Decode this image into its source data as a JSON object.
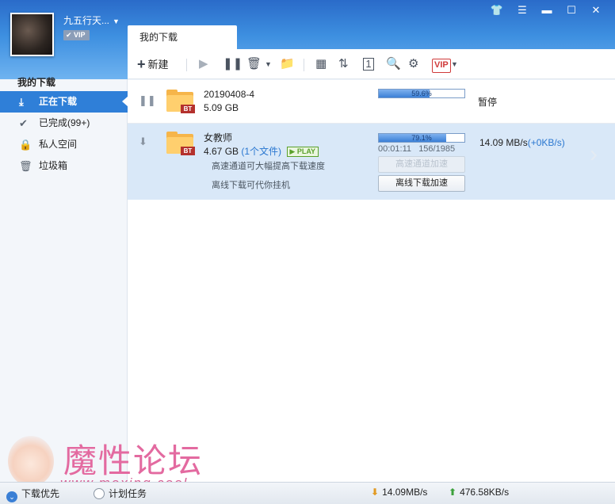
{
  "header": {
    "username": "九五行天...",
    "vip_label": "VIP",
    "tab_label": "我的下载"
  },
  "window_controls": [
    "skin-icon",
    "menu-icon",
    "minimize-icon",
    "maximize-icon",
    "close-icon"
  ],
  "toolbar": {
    "new_label": "新建",
    "vip_label": "VIP"
  },
  "sidebar": {
    "title": "我的下载",
    "items": [
      {
        "label": "正在下载",
        "icon": "download-icon",
        "active": true
      },
      {
        "label": "已完成(99+)",
        "icon": "check-icon",
        "active": false
      },
      {
        "label": "私人空间",
        "icon": "lock-icon",
        "active": false
      },
      {
        "label": "垃圾箱",
        "icon": "trash-icon",
        "active": false
      }
    ]
  },
  "tasks": [
    {
      "name": "20190408-4",
      "size": "5.09 GB",
      "file_tag": "BT",
      "progress_label": "59.6%",
      "progress": 0.596,
      "status": "暂停"
    },
    {
      "name": "女教师",
      "size": "4.67 GB",
      "file_count": "(1个文件)",
      "play_label": "PLAY",
      "file_tag": "BT",
      "progress_label": "79.1%",
      "progress": 0.791,
      "elapsed": "00:01:11",
      "pieces": "156/1985",
      "speed": "14.09  MB/s",
      "speed_extra": "(+0KB/s)",
      "hint_highspeed": "高速通道可大幅提高下载速度",
      "hint_offline": "离线下载可代你挂机",
      "btn_highspeed": "高速通道加速",
      "btn_offline": "离线下载加速"
    }
  ],
  "watermark": {
    "title": "魔性论坛",
    "url": "www.moxing.cool"
  },
  "statusbar": {
    "priority_label": "下载优先",
    "schedule_label": "计划任务",
    "down_speed": "14.09MB/s",
    "up_speed": "476.58KB/s"
  },
  "colors": {
    "accent": "#2f7fd8",
    "vip_red": "#d03a3a",
    "folder": "#f6b54a"
  }
}
